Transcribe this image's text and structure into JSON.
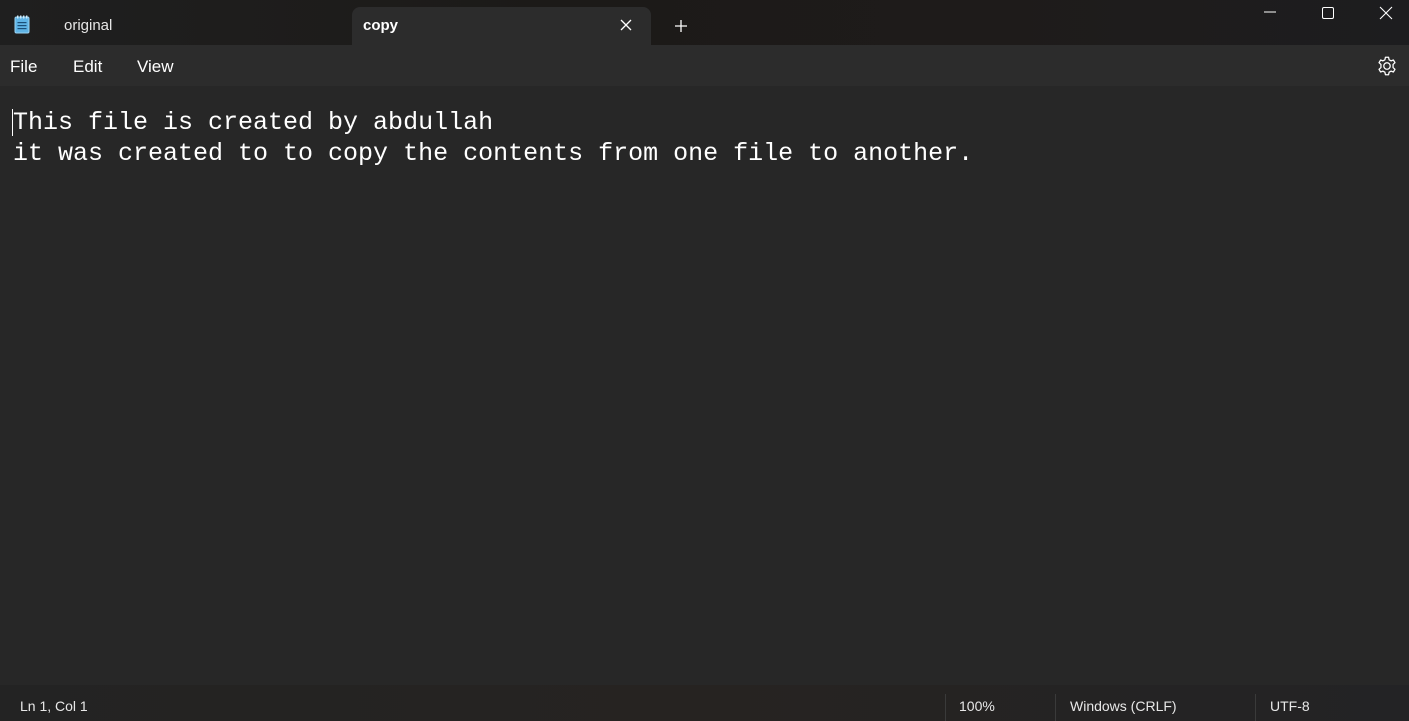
{
  "app": {
    "icon": "notepad-icon"
  },
  "tabs": [
    {
      "label": "original",
      "active": false
    },
    {
      "label": "copy",
      "active": true
    }
  ],
  "window_controls": {
    "minimize_icon": "minimize-icon",
    "maximize_icon": "maximize-icon",
    "close_icon": "close-icon"
  },
  "menu": {
    "file": "File",
    "edit": "Edit",
    "view": "View",
    "settings_icon": "gear-icon"
  },
  "editor": {
    "lines": [
      "This file is created by abdullah",
      "it was created to to copy the contents from one file to another."
    ]
  },
  "status": {
    "position": "Ln 1, Col 1",
    "zoom": "100%",
    "line_ending": "Windows (CRLF)",
    "encoding": "UTF-8"
  },
  "colors": {
    "background": "#272727",
    "toolbar": "#2c2c2c",
    "text": "#ffffff",
    "icon_accent": "#5fb4e6"
  }
}
